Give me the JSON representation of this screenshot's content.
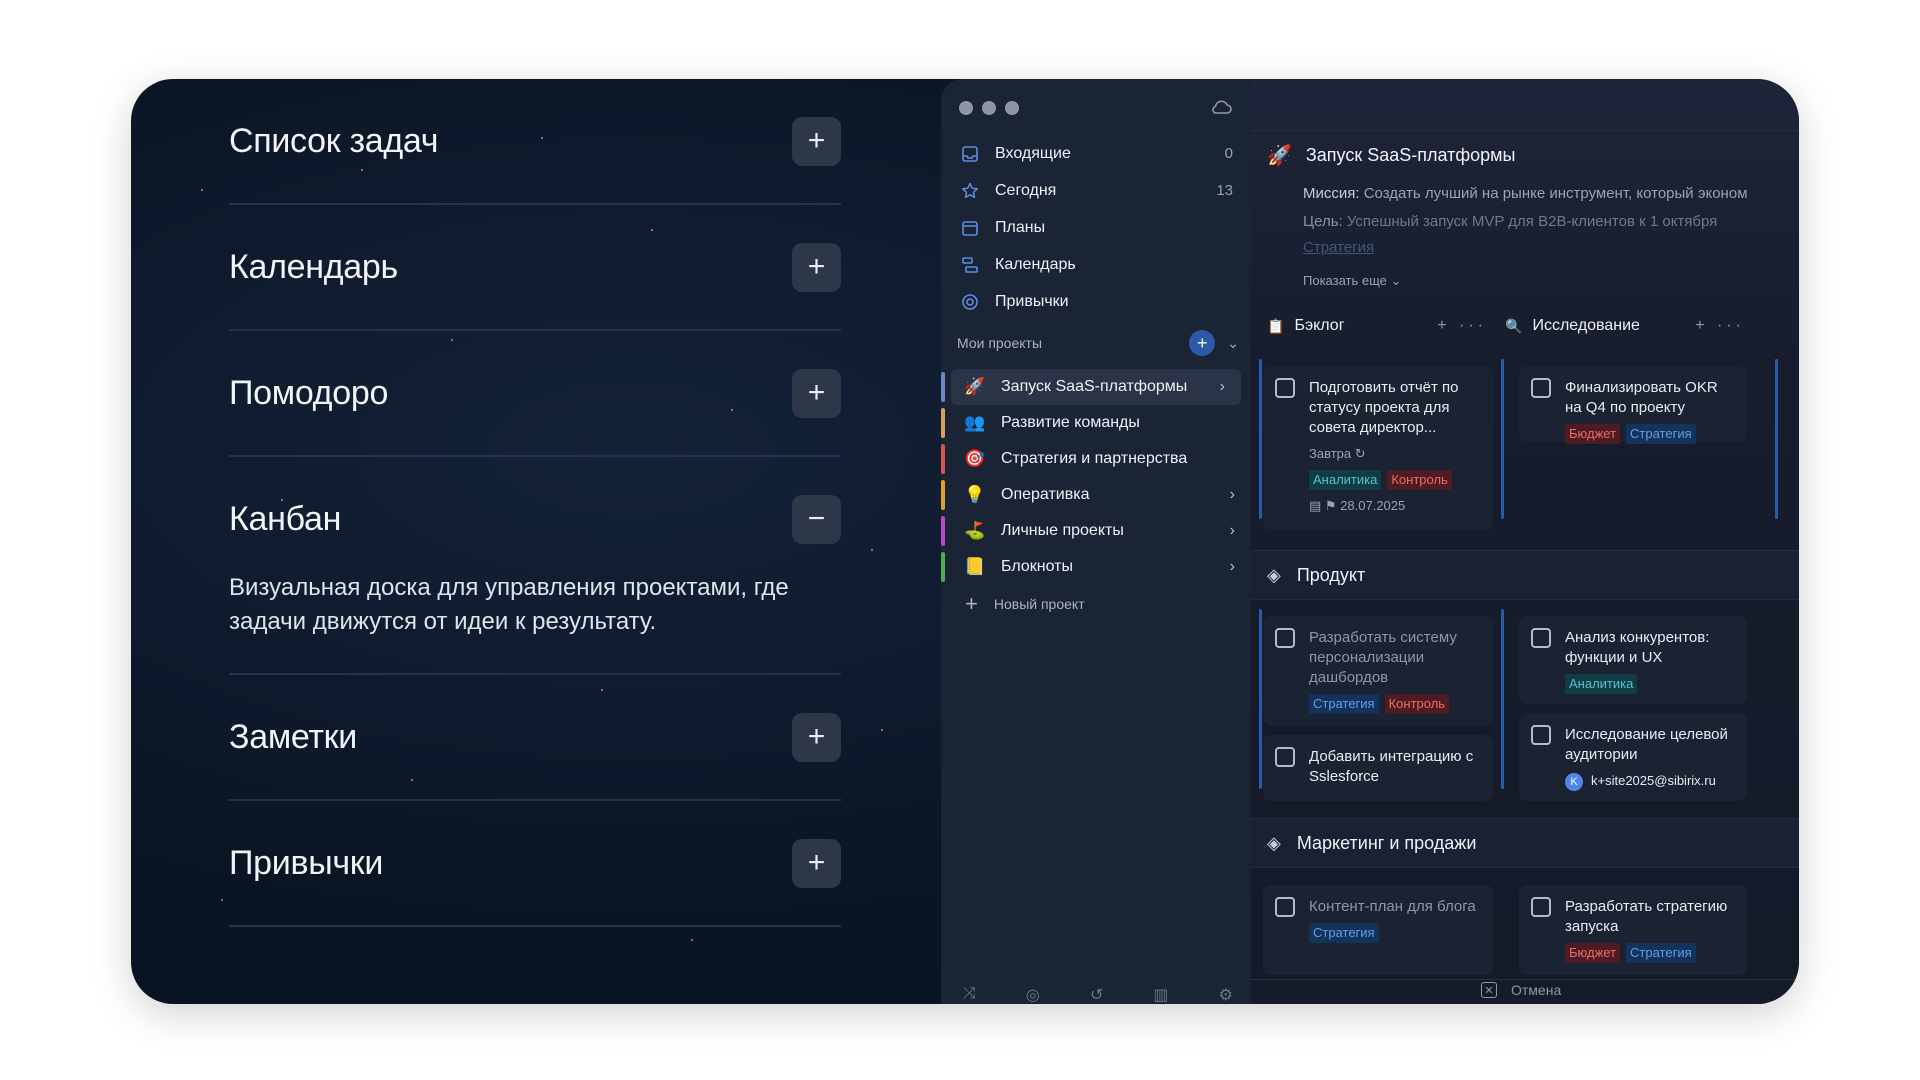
{
  "accordion": {
    "items": [
      {
        "title": "Список задач",
        "toggle": "+"
      },
      {
        "title": "Календарь",
        "toggle": "+"
      },
      {
        "title": "Помодоро",
        "toggle": "+"
      },
      {
        "title": "Канбан",
        "toggle": "−",
        "description": "Визуальная доска для управления проектами, где задачи движутся от идеи к результату."
      },
      {
        "title": "Заметки",
        "toggle": "+"
      },
      {
        "title": "Привычки",
        "toggle": "+"
      }
    ]
  },
  "sidebar": {
    "nav": [
      {
        "label": "Входящие",
        "count": "0",
        "icon": "inbox-icon"
      },
      {
        "label": "Сегодня",
        "count": "13",
        "icon": "star-icon"
      },
      {
        "label": "Планы",
        "count": "",
        "icon": "calendar-icon"
      },
      {
        "label": "Календарь",
        "count": "",
        "icon": "calendar-blocks-icon"
      },
      {
        "label": "Привычки",
        "count": "",
        "icon": "target-icon"
      }
    ],
    "projects_header": "Мои проекты",
    "projects": [
      {
        "label": "Запуск SaaS-платформы",
        "emoji": "🚀",
        "color": "#6f87c8",
        "has_arrow": true,
        "active": true
      },
      {
        "label": "Развитие команды",
        "emoji": "👥",
        "color": "#d9a05b",
        "has_arrow": false
      },
      {
        "label": "Стратегия и партнерства",
        "emoji": "🎯",
        "color": "#d9534f",
        "has_arrow": false
      },
      {
        "label": "Оперативка",
        "emoji": "💡",
        "color": "#e0a030",
        "has_arrow": true
      },
      {
        "label": "Личные проекты",
        "emoji": "⛳",
        "color": "#b24ac9",
        "has_arrow": true
      },
      {
        "label": "Блокноты",
        "emoji": "📒",
        "color": "#4caf50",
        "has_arrow": true
      }
    ],
    "new_project": "Новый проект"
  },
  "main": {
    "project_title": "Запуск SaaS-платформы",
    "mission_label": "Миссия:",
    "mission_text": "Создать лучший на рынке инструмент, который эконом",
    "goal_label": "Цель:",
    "goal_text": "Успешный запуск MVP для B2B-клиентов к 1 октября",
    "strategy_link": "Стратегия",
    "show_more": "Показать еще",
    "columns": [
      {
        "title": "Бэклог",
        "icon": "clipboard-icon"
      },
      {
        "title": "Исследование",
        "icon": "magnifier-icon"
      }
    ],
    "backlog_tasks": [
      {
        "title": "Подготовить отчёт по статусу проекта для совета директор...",
        "due": "Завтра",
        "tags": [
          "Аналитика",
          "Контроль"
        ],
        "date": "28.07.2025"
      }
    ],
    "research_tasks": [
      {
        "title": "Финализировать OKR на Q4 по проекту",
        "tags": [
          "Бюджет",
          "Стратегия"
        ]
      }
    ],
    "sections": [
      {
        "title": "Продукт",
        "tasks_col1": [
          {
            "title": "Разработать систему персонализации дашбордов",
            "tags": [
              "Стратегия",
              "Контроль"
            ]
          },
          {
            "title": "Добавить интеграцию с Sslesforce",
            "tags": []
          }
        ],
        "tasks_col2": [
          {
            "title": "Анализ конкурентов: функции и UX",
            "tags": [
              "Аналитика"
            ]
          },
          {
            "title": "Исследование целевой аудитории",
            "assignee_initial": "K",
            "assignee": "k+site2025@sibirix.ru"
          }
        ]
      },
      {
        "title": "Маркетинг и продажи",
        "tasks_col1": [
          {
            "title": "Контент-план для блога",
            "tags": [
              "Стратегия"
            ]
          }
        ],
        "tasks_col2": [
          {
            "title": "Разработать стратегию запуска",
            "tags": [
              "Бюджет",
              "Стратегия"
            ]
          }
        ]
      }
    ],
    "cancel_label": "Отмена"
  }
}
